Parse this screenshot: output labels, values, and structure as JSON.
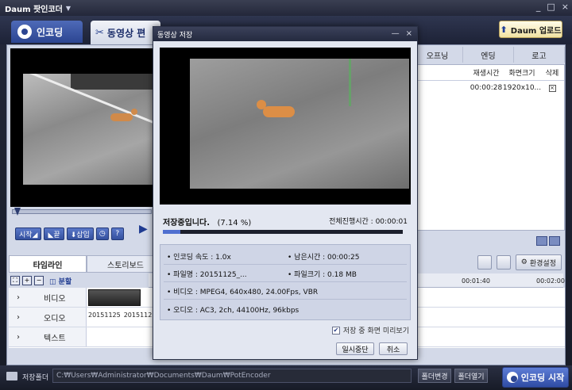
{
  "app": {
    "title": "Daum 팟인코더",
    "window_buttons": [
      "_",
      "□",
      "×"
    ]
  },
  "topbar": {
    "tab_encode": "인코딩",
    "tab_edit": "동영상 편",
    "upload_label": "Daum 업로드"
  },
  "preview": {
    "controls": [
      "시작◢",
      "◣끝",
      "⬇삽입",
      "◷",
      "?"
    ]
  },
  "list": {
    "tabs": [
      "오프닝",
      "엔딩",
      "로고"
    ],
    "headers": [
      "재생시간",
      "화면크기",
      "삭제"
    ],
    "rows": [
      {
        "duration": "00:00:28",
        "size": "1920x10...",
        "delete": "×"
      }
    ]
  },
  "timeline": {
    "tabs": [
      "타임라인",
      "스토리보드"
    ],
    "env_settings": "환경설정",
    "split_label": "◫ 분할",
    "ruler_ticks": [
      "00:01:40",
      "00:02:00"
    ],
    "tracks": [
      {
        "label": "비디오",
        "expand": "›"
      },
      {
        "label": "오디오",
        "expand": "›",
        "clips": [
          "20151125",
          "20151125"
        ]
      },
      {
        "label": "텍스트",
        "expand": "›"
      }
    ]
  },
  "statusbar": {
    "save_folder_label": "저장폴더",
    "path": "C:₩Users₩Administrator₩Documents₩Daum₩PotEncoder",
    "change_folder": "폴더변경",
    "open_folder": "폴더열기",
    "encode_start": "인코딩 시작"
  },
  "dialog": {
    "title": "동영상 저장",
    "buttons": [
      "—",
      "×"
    ],
    "status": "저장중입니다.",
    "percent": "(7.14 %)",
    "progress": 0.0714,
    "total_time_label": "전체진행시간 :",
    "total_time_value": "00:00:01",
    "info": {
      "encode_speed": "• 인코딩 속도 : 1.0x",
      "remaining": "• 남은시간 : 00:00:25",
      "filename": "• 파일명 : 20151125_...",
      "filesize": "• 파일크기 : 0.18 MB",
      "video": "• 비디오 : MPEG4, 640x480, 24.00Fps, VBR",
      "audio": "• 오디오 : AC3, 2ch, 44100Hz, 96kbps"
    },
    "preview_check_label": "저장 중 화면 미리보기",
    "pause_label": "일시중단",
    "cancel_label": "취소"
  }
}
